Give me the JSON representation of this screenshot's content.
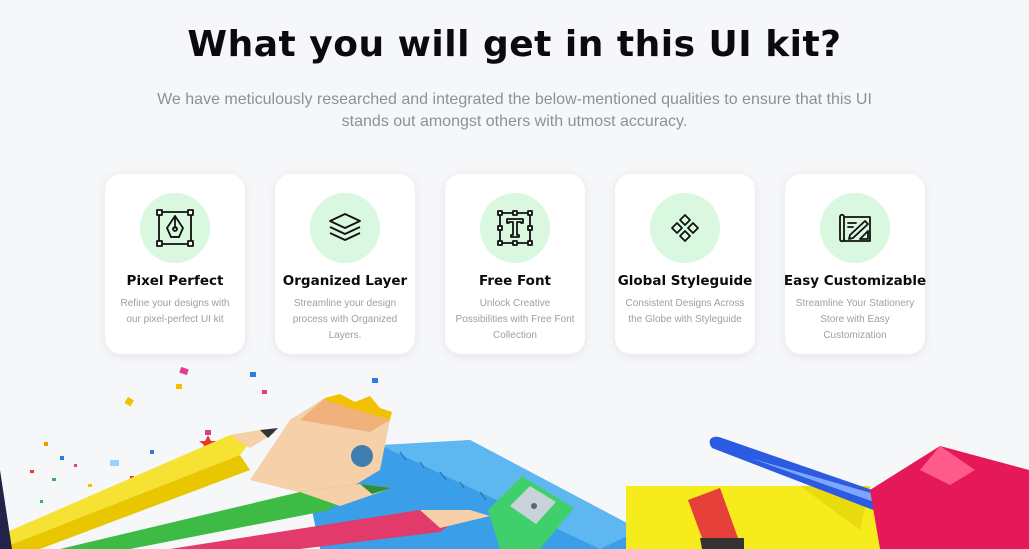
{
  "header": {
    "title": "What you will get in this UI kit?",
    "subtitle": "We have meticulously researched and integrated the below-mentioned qualities to ensure that this UI stands out amongst others with utmost accuracy."
  },
  "features": [
    {
      "icon": "pen-tool-icon",
      "title": "Pixel Perfect",
      "description": "Refine your designs with our pixel-perfect UI kit"
    },
    {
      "icon": "layers-icon",
      "title": "Organized Layer",
      "description": "Streamline your design process with Organized Layers."
    },
    {
      "icon": "text-type-icon",
      "title": "Free Font",
      "description": "Unlock Creative Possibilities with Free Font Collection"
    },
    {
      "icon": "components-icon",
      "title": "Global Styleguide",
      "description": "Consistent Designs Across the Globe with Styleguide"
    },
    {
      "icon": "blueprint-icon",
      "title": "Easy Customizable",
      "description": "Streamline Your Stationery Store with Easy Customization"
    }
  ],
  "colors": {
    "background": "#f6f7f9",
    "icon_circle": "#d9f8df",
    "title": "#0b0b0f",
    "muted_text": "#8b919a"
  }
}
